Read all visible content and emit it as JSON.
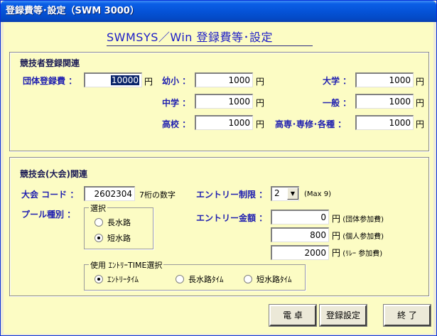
{
  "window": {
    "title": "登録費等･設定（SWM 3000）"
  },
  "heading": "SWMSYS／Win  登録費等･設定",
  "athlete_section": {
    "title": "競技者登録関連",
    "team_fee": {
      "label": "団体登録費 ：",
      "value": "10000",
      "unit": "円"
    },
    "youth": {
      "label": "幼小 ：",
      "value": "1000",
      "unit": "円"
    },
    "junior": {
      "label": "中学 ：",
      "value": "1000",
      "unit": "円"
    },
    "high": {
      "label": "高校 ：",
      "value": "1000",
      "unit": "円"
    },
    "university": {
      "label": "大学 ：",
      "value": "1000",
      "unit": "円"
    },
    "general": {
      "label": "一般 ：",
      "value": "1000",
      "unit": "円"
    },
    "other": {
      "label": "高専･専修･各種 ：",
      "value": "1000",
      "unit": "円"
    }
  },
  "meet_section": {
    "title": "競技会(大会)関連",
    "code": {
      "label": "大会 コード ：",
      "value": "2602304",
      "hint": "7桁の数字"
    },
    "entry_limit": {
      "label": "エントリー制限 ：",
      "value": "2",
      "hint": "(Max 9)"
    },
    "pool": {
      "label": "プール種別 ：",
      "group_title": "選択",
      "options": [
        "長水路",
        "短水路"
      ],
      "selected": "短水路"
    },
    "entry_fee": {
      "label": "エントリー金額 ：",
      "rows": [
        {
          "value": "0",
          "unit": "円",
          "note": "(団体参加費)"
        },
        {
          "value": "800",
          "unit": "円",
          "note": "(個人参加費)"
        },
        {
          "value": "2000",
          "unit": "円",
          "note": "(ﾘﾚｰ 参加費)"
        }
      ]
    },
    "entry_time": {
      "group_title": "使用 ｴﾝﾄﾘｰTIME選択",
      "options": [
        "ｴﾝﾄﾘｰﾀｲﾑ",
        "長水路ﾀｲﾑ",
        "短水路ﾀｲﾑ"
      ],
      "selected": "ｴﾝﾄﾘｰﾀｲﾑ"
    }
  },
  "buttons": {
    "calculator": "電 卓",
    "save": "登録設定",
    "exit": "終 了"
  }
}
